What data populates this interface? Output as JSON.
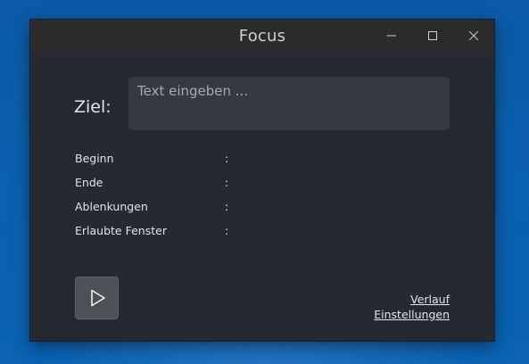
{
  "window": {
    "title": "Focus"
  },
  "goal": {
    "label": "Ziel:",
    "placeholder": "Text eingeben ...",
    "value": ""
  },
  "info": [
    {
      "label": "Beginn",
      "colon": ":",
      "value": ""
    },
    {
      "label": "Ende",
      "colon": ":",
      "value": ""
    },
    {
      "label": "Ablenkungen",
      "colon": ":",
      "value": ""
    },
    {
      "label": "Erlaubte Fenster",
      "colon": ":",
      "value": ""
    }
  ],
  "links": {
    "history": "Verlauf",
    "settings": "Einstellungen"
  },
  "icons": {
    "start": "play-icon",
    "minimize": "minimize-icon",
    "maximize": "maximize-icon",
    "close": "close-icon"
  },
  "colors": {
    "window_bg": "#242a30",
    "titlebar_bg": "#2b2b2b",
    "input_bg": "#353a40",
    "button_bg": "#4c5156",
    "desktop_bg": "#0b5fae"
  }
}
